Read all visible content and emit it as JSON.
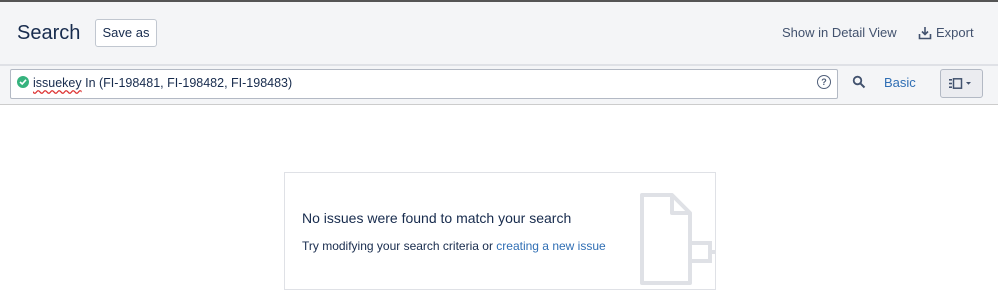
{
  "header": {
    "title": "Search",
    "save_as_label": "Save as",
    "detail_view_label": "Show in Detail View",
    "export_label": "Export"
  },
  "search": {
    "query_keyword": "issuekey",
    "query_rest": " In (FI-198481, FI-198482, FI-198483)",
    "basic_label": "Basic",
    "status_icon": "check-circle-icon",
    "help_icon": "question-icon",
    "search_icon": "search-icon",
    "layout_icon": "list-view-icon"
  },
  "empty_state": {
    "title": "No issues were found to match your search",
    "hint_prefix": "Try modifying your search criteria or ",
    "hint_link": "creating a new issue"
  },
  "colors": {
    "link": "#2f6eb4",
    "valid": "#36b37e",
    "header_bg": "#f4f5f7"
  }
}
